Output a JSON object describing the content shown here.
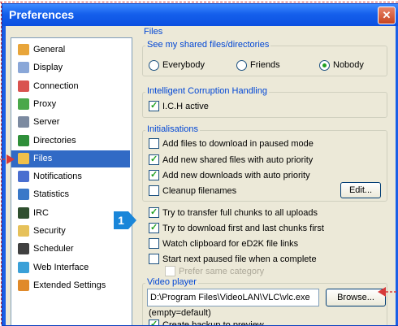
{
  "window": {
    "title": "Preferences",
    "close_label": "✕"
  },
  "sidebar": {
    "items": [
      {
        "label": "General",
        "icon": "general-icon",
        "color": "#e8a53a"
      },
      {
        "label": "Display",
        "icon": "display-icon",
        "color": "#8aa7d8"
      },
      {
        "label": "Connection",
        "icon": "connection-icon",
        "color": "#d9534f"
      },
      {
        "label": "Proxy",
        "icon": "proxy-icon",
        "color": "#4aa84a"
      },
      {
        "label": "Server",
        "icon": "server-icon",
        "color": "#7c8aa0"
      },
      {
        "label": "Directories",
        "icon": "directories-icon",
        "color": "#2f8f3a"
      },
      {
        "label": "Files",
        "icon": "files-icon",
        "color": "#f0c04a"
      },
      {
        "label": "Notifications",
        "icon": "notifications-icon",
        "color": "#4a6fd0"
      },
      {
        "label": "Statistics",
        "icon": "statistics-icon",
        "color": "#3a78c8"
      },
      {
        "label": "IRC",
        "icon": "irc-icon",
        "color": "#2f4f2f"
      },
      {
        "label": "Security",
        "icon": "security-icon",
        "color": "#e6c15a"
      },
      {
        "label": "Scheduler",
        "icon": "scheduler-icon",
        "color": "#404040"
      },
      {
        "label": "Web Interface",
        "icon": "web-interface-icon",
        "color": "#3aa0d8"
      },
      {
        "label": "Extended Settings",
        "icon": "extended-settings-icon",
        "color": "#e08a2a"
      }
    ],
    "selected_index": 6
  },
  "files": {
    "section_label": "Files",
    "shared_group": {
      "label": "See my shared files/directories",
      "options": [
        "Everybody",
        "Friends",
        "Nobody"
      ],
      "selected": "Nobody"
    },
    "ich_group": {
      "label": "Intelligent Corruption Handling",
      "ich_active": "I.C.H active"
    },
    "init_group": {
      "label": "Initialisations",
      "paused_mode": "Add files to download in paused mode",
      "shared_auto": "Add new shared files with auto priority",
      "downloads_auto": "Add new downloads with auto priority",
      "cleanup": "Cleanup filenames",
      "edit_button": "Edit..."
    },
    "options": {
      "transfer_chunks": "Try to transfer full chunks to all uploads",
      "download_first_last": "Try to download first and last chunks first",
      "watch_clipboard": "Watch clipboard for eD2K file links",
      "start_next": "Start next paused file when a complete",
      "prefer_same": "Prefer same category"
    },
    "video_group": {
      "label": "Video player",
      "path_value": "D:\\Program Files\\VideoLAN\\VLC\\vlc.exe",
      "browse_button": "Browse...",
      "empty_default": "(empty=default)",
      "create_backup": "Create backup to preview"
    }
  },
  "callout": {
    "number": "1"
  },
  "checks": {
    "ich_active": true,
    "paused_mode": false,
    "shared_auto": true,
    "downloads_auto": true,
    "cleanup": false,
    "transfer_chunks": true,
    "download_first_last": true,
    "watch_clipboard": false,
    "start_next": false,
    "prefer_same": false,
    "create_backup": true
  }
}
